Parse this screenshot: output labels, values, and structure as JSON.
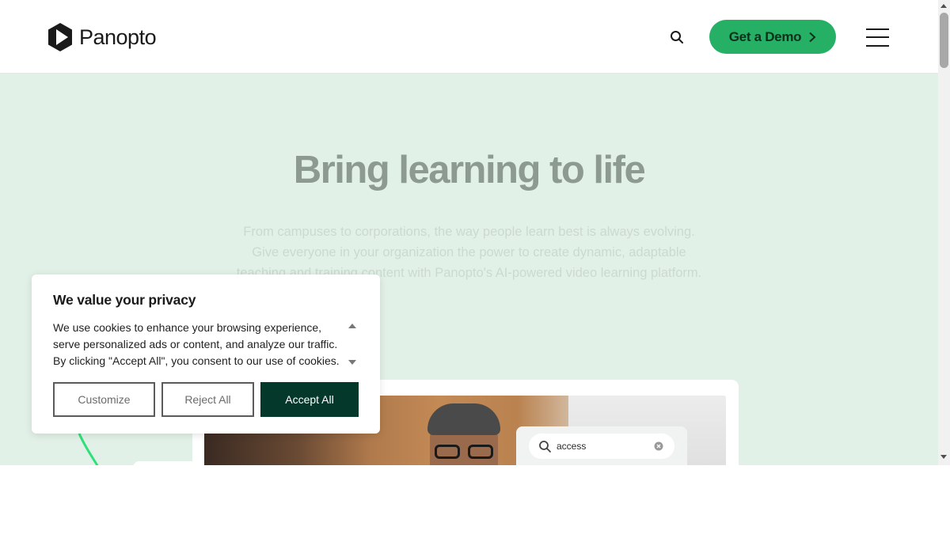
{
  "header": {
    "logo_text": "Panopto",
    "logo_icon": "panopto-play-hexagon-icon",
    "search_icon": "search-icon",
    "demo_label": "Get a Demo",
    "demo_icon": "chevron-right-icon",
    "menu_icon": "hamburger-menu-icon"
  },
  "hero": {
    "title": "Bring learning to life",
    "description": "From campuses to corporations, the way people learn best is always evolving. Give everyone in your organization the power to create dynamic, adaptable teaching and training content with Panopto's AI-powered video learning platform."
  },
  "preview": {
    "search_value": "access",
    "search_icon": "search-icon",
    "clear_icon": "clear-circle-icon"
  },
  "cookie": {
    "title": "We value your privacy",
    "body": "We use cookies to enhance your browsing experience, serve personalized ads or content, and analyze our traffic. By clicking \"Accept All\", you consent to our use of cookies.",
    "customize_label": "Customize",
    "reject_label": "Reject All",
    "accept_label": "Accept All"
  },
  "colors": {
    "accent_green": "#26b065",
    "hero_bg": "#e2f1e8",
    "accept_bg": "#04382a"
  }
}
